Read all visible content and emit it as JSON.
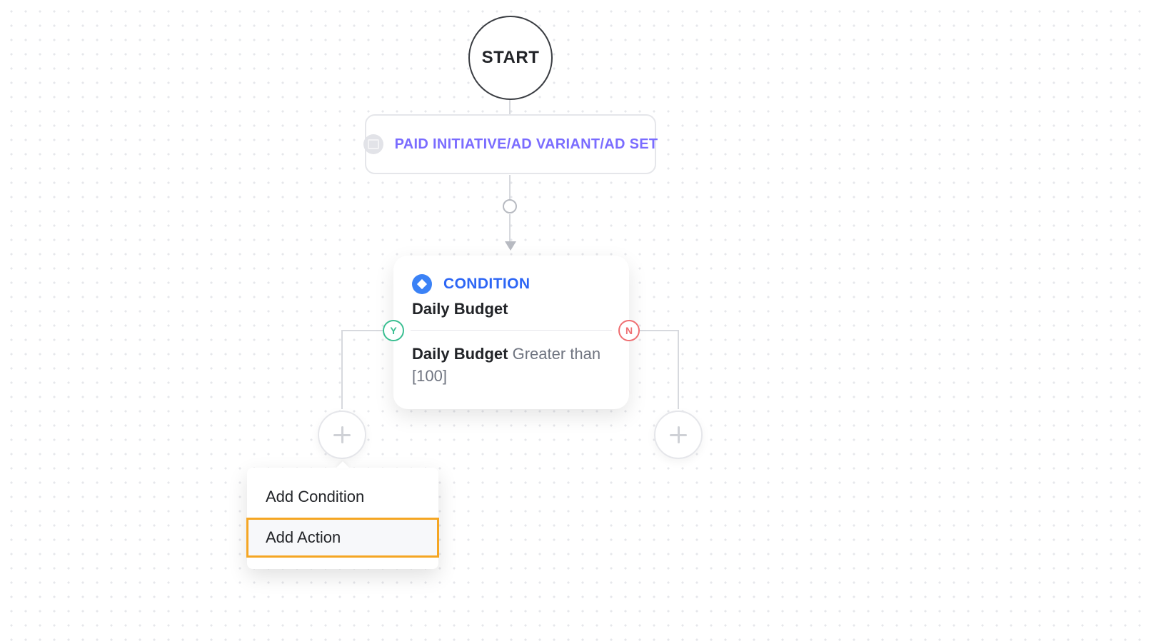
{
  "start": {
    "label": "START"
  },
  "entity": {
    "label": "PAID INITIATIVE/AD VARIANT/AD SET"
  },
  "condition": {
    "type_label": "CONDITION",
    "title": "Daily Budget",
    "field": "Daily Budget",
    "operator_and_value": "Greater than [100]"
  },
  "branches": {
    "yes_label": "Y",
    "no_label": "N"
  },
  "dropdown": {
    "add_condition": "Add Condition",
    "add_action": "Add Action"
  }
}
